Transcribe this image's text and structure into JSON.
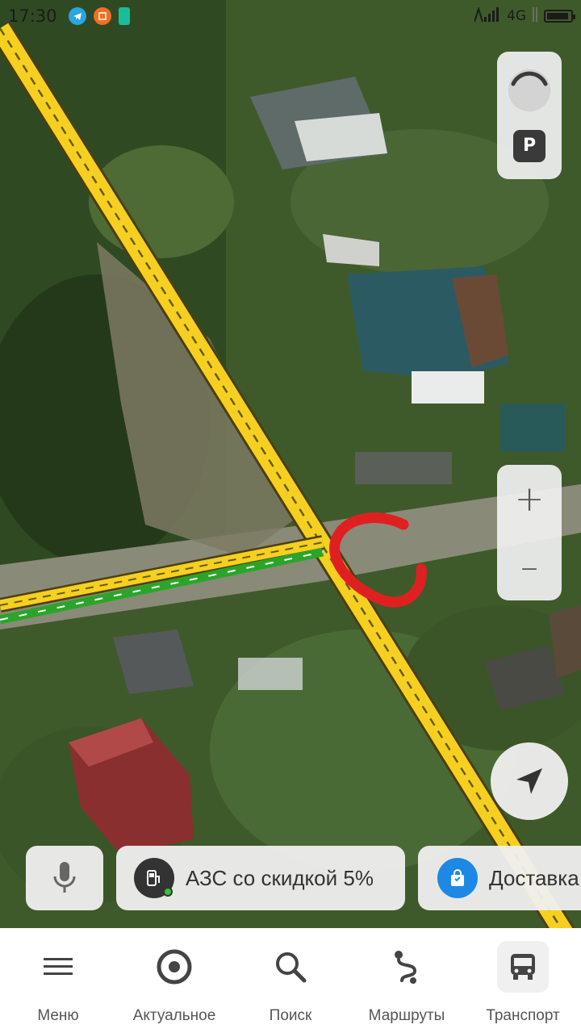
{
  "status_bar": {
    "time": "17:30",
    "network": "4G",
    "battery_level": 0.85
  },
  "map": {
    "view": "satellite",
    "route_marker_color": "#e02020",
    "road_color": "#f5d020",
    "route_color": "#2aa52a"
  },
  "controls": {
    "traffic_icon": "traffic-light-icon",
    "parking_label": "P",
    "zoom_in_label": "+",
    "zoom_out_label": "–"
  },
  "chips": {
    "fuel_label": "АЗС со скидкой 5%",
    "delivery_label": "Доставка"
  },
  "bottom_nav": {
    "items": [
      {
        "label": "Меню",
        "icon": "menu-icon"
      },
      {
        "label": "Актуальное",
        "icon": "target-icon"
      },
      {
        "label": "Поиск",
        "icon": "search-icon"
      },
      {
        "label": "Маршруты",
        "icon": "route-icon"
      },
      {
        "label": "Транспорт",
        "icon": "bus-icon"
      }
    ],
    "active_index": 4
  }
}
